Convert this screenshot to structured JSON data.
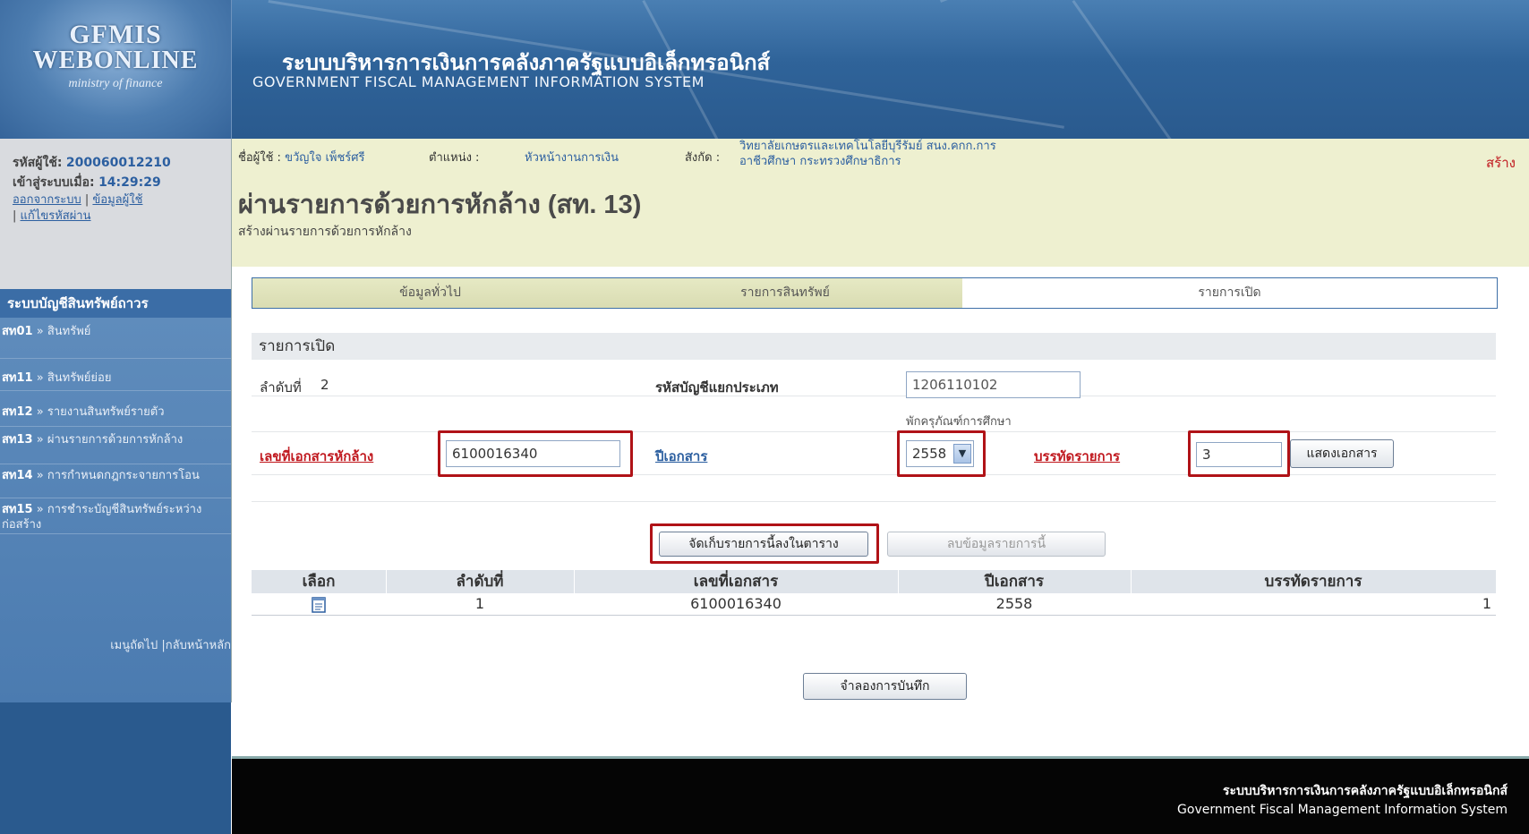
{
  "header": {
    "logo_line1": "GFMIS",
    "logo_line2": "WEBONLINE",
    "logo_line3": "ministry of finance",
    "system_title_th": "ระบบบริหารการเงินการคลังภาครัฐแบบอิเล็กทรอนิกส์",
    "system_title_en": "GOVERNMENT FISCAL MANAGEMENT INFORMATION SYSTEM"
  },
  "user_info": {
    "user_id_label": "รหัสผู้ใช้:",
    "user_id": "200060012210",
    "login_label": "เข้าสู่ระบบเมื่อ:",
    "login_time": "14:29:29",
    "logout": "ออกจากระบบ",
    "profile": "ข้อมูลผู้ใช้",
    "change_password": "แก้ไขรหัสผ่าน",
    "separator": "|"
  },
  "menu": {
    "title": "ระบบบัญชีสินทรัพย์ถาวร",
    "items": [
      {
        "code": "สท01",
        "label": "สินทรัพย์"
      },
      {
        "code": "สท11",
        "label": "สินทรัพย์ย่อย"
      },
      {
        "code": "สท12",
        "label": "รายงานสินทรัพย์รายตัว"
      },
      {
        "code": "สท13",
        "label": "ผ่านรายการด้วยการหักล้าง"
      },
      {
        "code": "สท14",
        "label": "การกำหนดกฎกระจายการโอน"
      },
      {
        "code": "สท15",
        "label": "การชำระบัญชีสินทรัพย์ระหว่างก่อสร้าง"
      }
    ],
    "arrow": "»",
    "footer": "เมนูถัดไป |กลับหน้าหลัก"
  },
  "topbar": {
    "user_label": "ชื่อผู้ใช้ :",
    "user_name": "ขวัญใจ เพ็ชร์ศรี",
    "position_label": "ตำแหน่ง :",
    "position": "หัวหน้างานการเงิน",
    "affiliation_label": "สังกัด :",
    "affiliation_line1": "วิทยาลัยเกษตรและเทคโนโลยีบุรีรัมย์ สนง.คกก.การ",
    "affiliation_line2": "อาชีวศึกษา กระทรวงศึกษาธิการ",
    "action": "สร้าง"
  },
  "page": {
    "title": "ผ่านรายการด้วยการหักล้าง (สท. 13)",
    "subtitle": "สร้างผ่านรายการด้วยการหักล้าง"
  },
  "tabs": [
    "ข้อมูลทั่วไป",
    "รายการสินทรัพย์",
    "รายการเปิด"
  ],
  "form": {
    "section_title": "รายการเปิด",
    "seq_label": "ลำดับที่",
    "seq_value": "2",
    "gl_label": "รหัสบัญชีแยกประเภท",
    "gl_value": "1206110102",
    "gl_desc": "พักครุภัณฑ์การศึกษา",
    "doc_no_label": "เลขที่เอกสารหักล้าง",
    "doc_no_value": "6100016340",
    "doc_year_label": "ปีเอกสาร",
    "doc_year_value": "2558",
    "line_label": "บรรทัดรายการ",
    "line_value": "3",
    "show_doc_button": "แสดงเอกสาร",
    "save_row_button": "จัดเก็บรายการนี้ลงในตาราง",
    "delete_row_button": "ลบข้อมูลรายการนี้",
    "simulate_button": "จำลองการบันทึก"
  },
  "table": {
    "headers": [
      "เลือก",
      "ลำดับที่",
      "เลขที่เอกสาร",
      "ปีเอกสาร",
      "บรรทัดรายการ"
    ],
    "rows": [
      {
        "seq": "1",
        "doc_no": "6100016340",
        "year": "2558",
        "line": "1"
      }
    ]
  },
  "footer": {
    "line1": "ระบบบริหารการเงินการคลังภาครัฐแบบอิเล็กทรอนิกส์",
    "line2": "Government Fiscal Management Information System"
  },
  "colors": {
    "header_blue": "#2f6399",
    "info_bar": "#eef0d0",
    "required_red": "#c0181e",
    "highlight_border": "#b01217",
    "link_blue": "#2c5fa0"
  }
}
